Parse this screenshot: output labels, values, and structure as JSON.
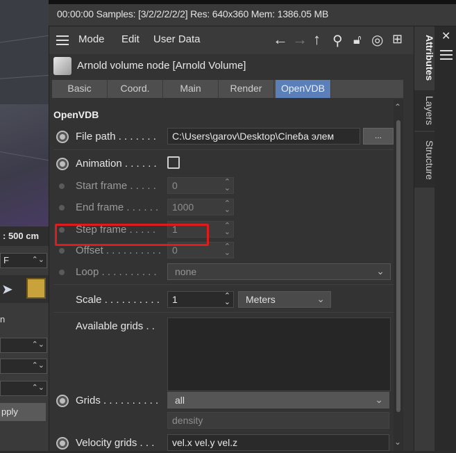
{
  "status": {
    "text": "00:00:00  Samples: [3/2/2/2/2/2]  Res: 640x360  Mem: 1386.05 MB"
  },
  "viewport": {
    "distance_label": ": 500 cm"
  },
  "left_panel": {
    "field1": "F",
    "apply_label": "pply",
    "n_label": "n"
  },
  "menu": {
    "mode": "Mode",
    "edit": "Edit",
    "user_data": "User Data"
  },
  "object": {
    "title": "Arnold volume node [Arnold Volume]"
  },
  "tabs": [
    {
      "label": "Basic",
      "active": false
    },
    {
      "label": "Coord.",
      "active": false
    },
    {
      "label": "Main",
      "active": false
    },
    {
      "label": "Render",
      "active": false
    },
    {
      "label": "OpenVDB",
      "active": true
    }
  ],
  "section": {
    "title": "OpenVDB"
  },
  "params": {
    "file_path": {
      "label": "File path . . . . . . .",
      "value": "C:\\Users\\garov\\Desktop\\Cineɓa элем",
      "browse": "..."
    },
    "animation": {
      "label": "Animation . . . . . .",
      "checked": false
    },
    "start_frame": {
      "label": "Start frame . . . . .",
      "value": "0"
    },
    "end_frame": {
      "label": "End frame . . . . . .",
      "value": "1000"
    },
    "step_frame": {
      "label": "Step frame . . . . .",
      "value": "1"
    },
    "offset": {
      "label": "Offset . . . . . . . . . .",
      "value": "0"
    },
    "loop": {
      "label": "Loop . . . . . . . . . .",
      "value": "none"
    },
    "scale": {
      "label": "Scale . . . . . . . . . .",
      "value": "1",
      "unit": "Meters"
    },
    "available_grids": {
      "label": "Available grids . ."
    },
    "grids": {
      "label": "Grids . . . . . . . . . .",
      "value": "all",
      "sub": "density"
    },
    "velocity_grids": {
      "label": "Velocity grids . . .",
      "value": "vel.x vel.y vel.z"
    }
  },
  "side_tabs": {
    "attributes": "Attributes",
    "layers": "Layers",
    "structure": "Structure"
  },
  "colors": {
    "highlight": "#e01b1b",
    "active_tab": "#5b7fb8"
  }
}
